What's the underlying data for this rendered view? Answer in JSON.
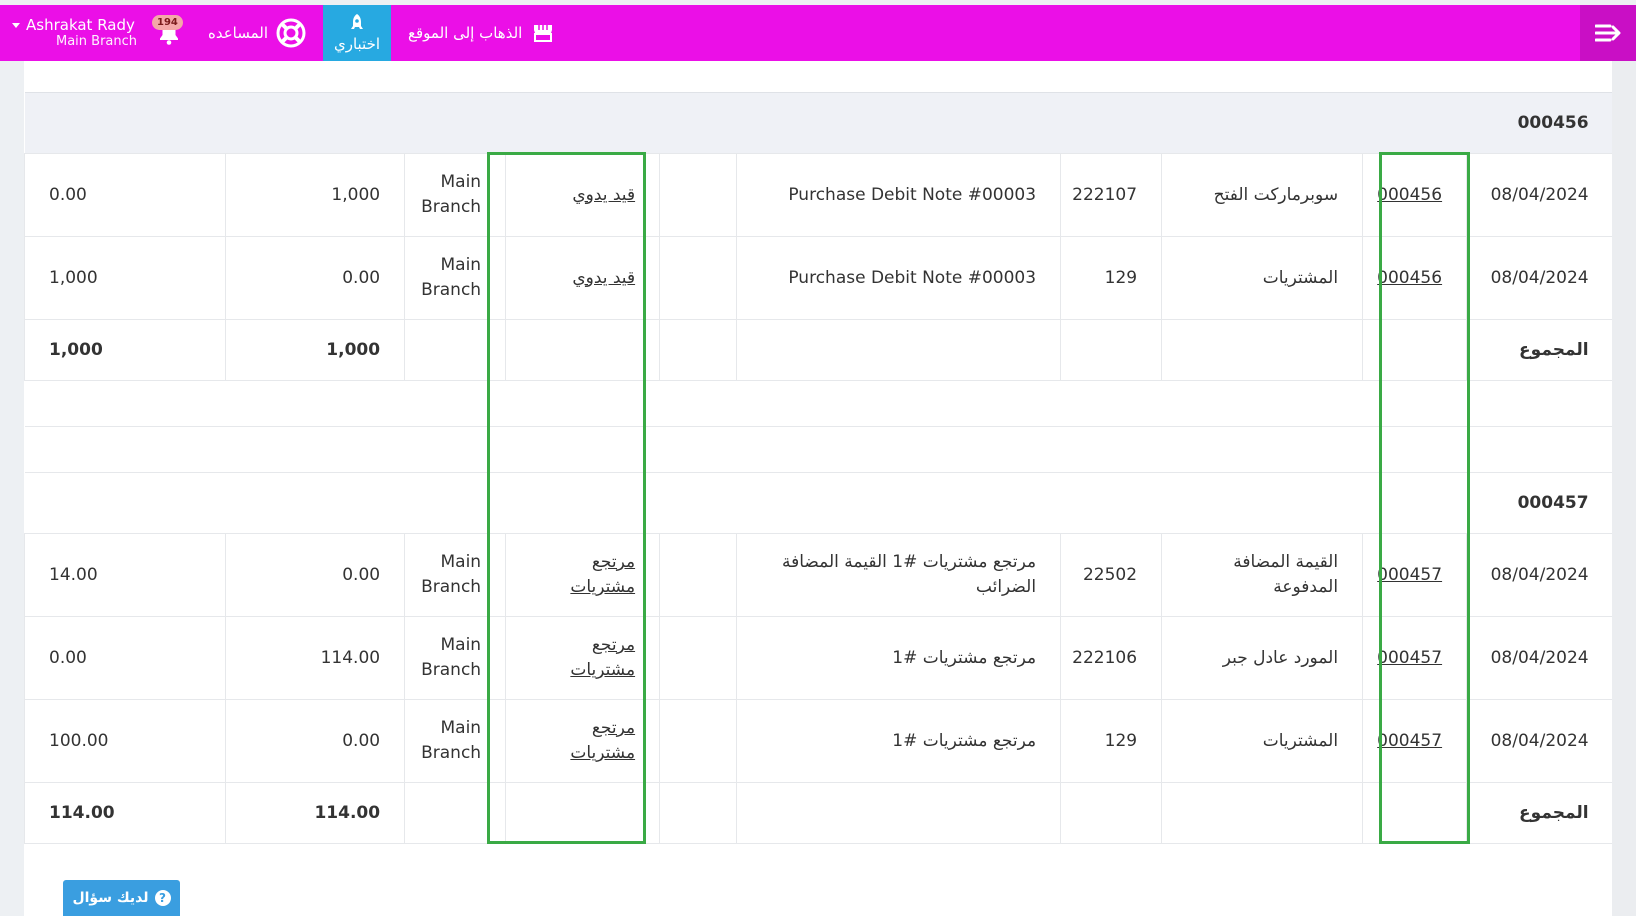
{
  "header": {
    "user_name": "Ashrakat Rady",
    "branch": "Main Branch",
    "notifications_count": "194",
    "help_label": "المساعده",
    "try_label": "اختباري",
    "site_label": "الذهاب إلى الموقع"
  },
  "groups": [
    {
      "title": "000456",
      "rows": [
        {
          "date": "08/04/2024",
          "number": "000456",
          "account": "سوبرماركت الفتح",
          "code": "222107",
          "description": "Purchase Debit Note #00003",
          "source": "قيد يدوي",
          "branch": "Main Branch",
          "debit": "1,000",
          "credit": "0.00"
        },
        {
          "date": "08/04/2024",
          "number": "000456",
          "account": "المشتريات",
          "code": "129",
          "description": "Purchase Debit Note #00003",
          "source": "قيد يدوي",
          "branch": "Main Branch",
          "debit": "0.00",
          "credit": "1,000"
        }
      ],
      "total": {
        "label": "المجموع",
        "debit": "1,000",
        "credit": "1,000"
      }
    },
    {
      "title": "000457",
      "rows": [
        {
          "date": "08/04/2024",
          "number": "000457",
          "account": "القيمة المضافة المدفوعة",
          "code": "22502",
          "description": "مرتجع مشتريات #1 القيمة المضافة الضرائب",
          "source": "مرتجع مشتريات",
          "branch": "Main Branch",
          "debit": "0.00",
          "credit": "14.00"
        },
        {
          "date": "08/04/2024",
          "number": "000457",
          "account": "المورد عادل جبر",
          "code": "222106",
          "description": "مرتجع مشتريات #1",
          "source": "مرتجع مشتريات",
          "branch": "Main Branch",
          "debit": "114.00",
          "credit": "0.00"
        },
        {
          "date": "08/04/2024",
          "number": "000457",
          "account": "المشتريات",
          "code": "129",
          "description": "مرتجع مشتريات #1",
          "source": "مرتجع مشتريات",
          "branch": "Main Branch",
          "debit": "0.00",
          "credit": "100.00"
        }
      ],
      "total": {
        "label": "المجموع",
        "debit": "114.00",
        "credit": "114.00"
      }
    }
  ],
  "help_button": {
    "label": "لديك سؤال",
    "icon": "?"
  },
  "colors": {
    "topbar": "#eb0fe7",
    "accent": "#27a9e1",
    "highlight": "#3aaa45"
  }
}
